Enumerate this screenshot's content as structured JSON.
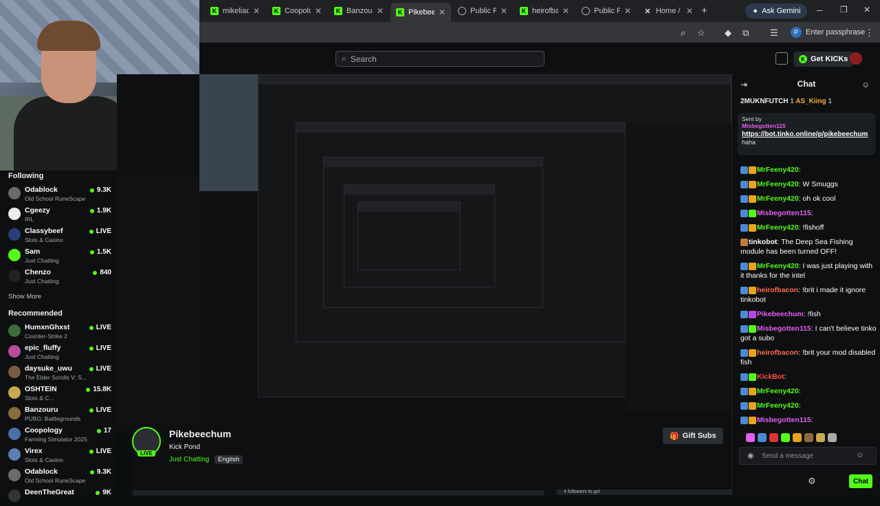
{
  "browser": {
    "tabs": [
      {
        "label": "mikeliac",
        "icon": "kick-icon"
      },
      {
        "label": "Coopolo",
        "icon": "kick-icon"
      },
      {
        "label": "Banzour",
        "icon": "kick-icon"
      },
      {
        "label": "Pikebee",
        "icon": "kick-icon"
      },
      {
        "label": "Public Pr",
        "icon": "globe-icon"
      },
      {
        "label": "heirofba",
        "icon": "kick-icon"
      },
      {
        "label": "Public Pr",
        "icon": "globe-icon"
      },
      {
        "label": "Home / X",
        "icon": "x-icon"
      }
    ],
    "ask_gemini": "Ask Gemini",
    "passphrase": "Enter passphrase"
  },
  "header": {
    "search_placeholder": "Search",
    "get_kicks": "Get KICKs"
  },
  "sidebar": {
    "following_title": "Following",
    "following": [
      {
        "name": "Odablock",
        "category": "Old School RuneScape",
        "viewers": "9.3K"
      },
      {
        "name": "Cgeezy",
        "category": "IRL",
        "viewers": "1.9K"
      },
      {
        "name": "Classybeef",
        "category": "Slots & Casino",
        "viewers": "LIVE"
      },
      {
        "name": "Sam",
        "category": "Just Chatting",
        "viewers": "1.5K"
      },
      {
        "name": "Chenzo",
        "category": "Just Chatting",
        "viewers": "840"
      }
    ],
    "show_more": "Show More",
    "recommended_title": "Recommended",
    "recommended": [
      {
        "name": "HumxnGhxst",
        "category": "Counter-Strike 2",
        "viewers": "LIVE"
      },
      {
        "name": "epic_fluffy",
        "category": "Just Chatting",
        "viewers": "LIVE"
      },
      {
        "name": "daysuke_uwu",
        "category": "The Elder Scrolls V: S...",
        "viewers": "LIVE"
      },
      {
        "name": "OSHTEIN",
        "category": "Slots & C...",
        "viewers": "15.8K"
      },
      {
        "name": "Banzouru",
        "category": "PUBG: Battlegrounds",
        "viewers": "LIVE"
      },
      {
        "name": "Coopology",
        "category": "Farming Simulator 2025",
        "viewers": "17"
      },
      {
        "name": "Virex",
        "category": "Slots & Casino",
        "viewers": "LIVE"
      },
      {
        "name": "Odablock",
        "category": "Old School RuneScape",
        "viewers": "9.3K"
      },
      {
        "name": "DeenTheGreat",
        "category": "",
        "viewers": "9K"
      }
    ]
  },
  "stream": {
    "name": "Pikebeechum",
    "title": "Kick Pond",
    "category": "Just Chatting",
    "language": "English",
    "live_badge": "LIVE",
    "gift_subs": "Gift Subs",
    "followers_text": "4 followers to go!"
  },
  "chat": {
    "title": "Chat",
    "gifters": [
      "2MUKNFUTCH",
      "1",
      "AS_Kiing",
      "1"
    ],
    "pinned": {
      "sent_by": "Sent by",
      "user": "Misbegotten115",
      "link": "https://bot.tinko.online/p/pikebeechum",
      "tail": "haha"
    },
    "messages": [
      {
        "user": "MrFeeny420",
        "color": "#53fc18",
        "text": ""
      },
      {
        "user": "MrFeeny420",
        "color": "#53fc18",
        "text": "W Smuggs"
      },
      {
        "user": "MrFeeny420",
        "color": "#53fc18",
        "text": "oh ok cool"
      },
      {
        "user": "Misbegotten115",
        "color": "#e55ef2",
        "text": ""
      },
      {
        "user": "MrFeeny420",
        "color": "#53fc18",
        "text": "!fishoff"
      },
      {
        "user": "tinkobot",
        "color": "#ffffff",
        "text": "The Deep Sea Fishing module has been turned OFF!"
      },
      {
        "user": "MrFeeny420",
        "color": "#53fc18",
        "text": "I was just playing with it thanks for the intel"
      },
      {
        "user": "heirofbacon",
        "color": "#ff6a4d",
        "text": "!brit i made it ignore tinkobot"
      },
      {
        "user": "Pikebeechum",
        "color": "#e55ef2",
        "text": "!fish"
      },
      {
        "user": "Misbegotten115",
        "color": "#e55ef2",
        "text": "I can't believe tinko got a subo"
      },
      {
        "user": "heirofbacon",
        "color": "#ff6a4d",
        "text": "!brit your mod disabled fish"
      },
      {
        "user": "KickBot",
        "color": "#ff4d4d",
        "text": ""
      },
      {
        "user": "MrFeeny420",
        "color": "#53fc18",
        "text": ""
      },
      {
        "user": "MrFeeny420",
        "color": "#53fc18",
        "text": ""
      },
      {
        "user": "Misbegotten115",
        "color": "#e55ef2",
        "text": ""
      }
    ],
    "input_placeholder": "Send a message",
    "send_button": "Chat"
  },
  "colors": {
    "accent": "#53fc18",
    "bg": "#0d0f10"
  }
}
